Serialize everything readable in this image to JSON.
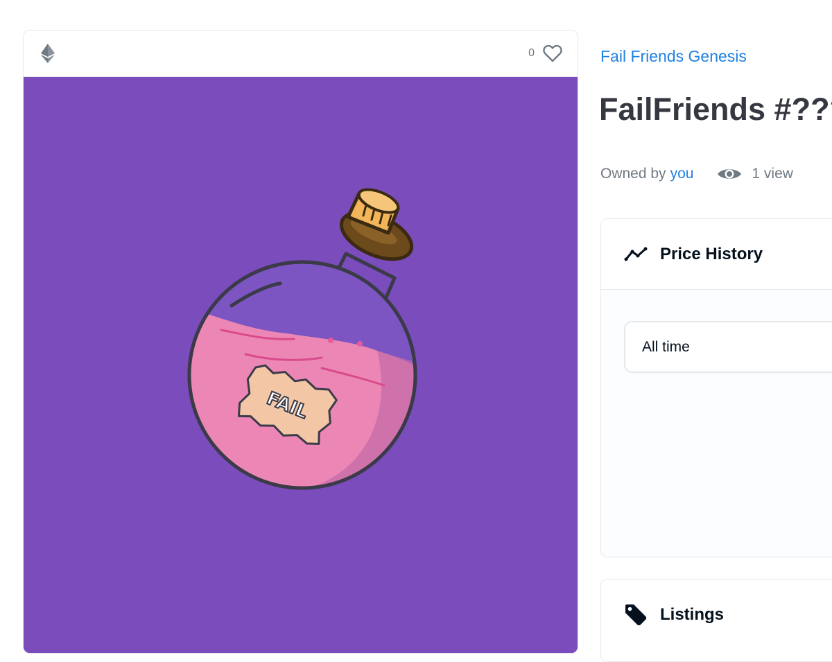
{
  "media": {
    "chain_icon": "ethereum-icon",
    "favorite_count": "0",
    "favorite_icon": "heart-outline-icon",
    "background_color": "#7a4cbc",
    "label_text": "FAIL"
  },
  "item": {
    "collection_name": "Fail Friends Genesis",
    "title": "FailFriends #???",
    "owned_by_label": "Owned by",
    "owner": "you",
    "views": "1 view",
    "views_icon": "eye-icon"
  },
  "price_history": {
    "icon": "line-chart-icon",
    "title": "Price History",
    "period": "All time"
  },
  "listings": {
    "icon": "price-tag-icon",
    "title": "Listings"
  },
  "colors": {
    "accent": "#2081e2",
    "text": "#353840",
    "muted": "#707a83"
  }
}
